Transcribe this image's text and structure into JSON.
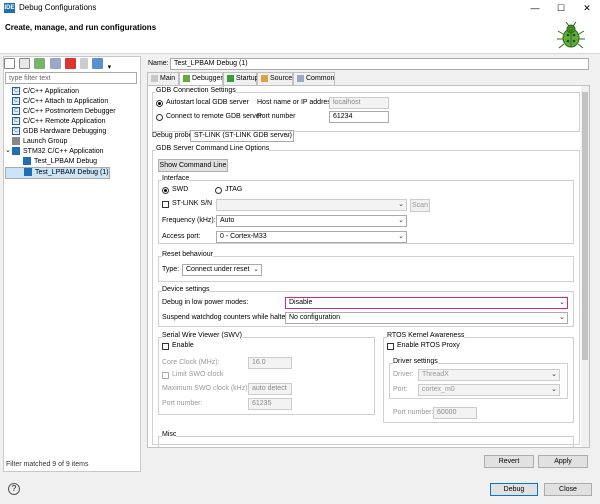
{
  "window": {
    "title": "Debug Configurations",
    "app_icon_text": "IDE",
    "minimize": "—",
    "maximize": "☐",
    "close": "✕"
  },
  "header": {
    "title": "Create, manage, and run configurations"
  },
  "left": {
    "filter_placeholder": "type filter text",
    "tree": [
      {
        "label": "C/C++ Application",
        "icon": "c-app-icon",
        "indent": 1
      },
      {
        "label": "C/C++ Attach to Application",
        "icon": "c-app-icon",
        "indent": 1
      },
      {
        "label": "C/C++ Postmortem Debugger",
        "icon": "c-app-icon",
        "indent": 1
      },
      {
        "label": "C/C++ Remote Application",
        "icon": "c-app-icon",
        "indent": 1
      },
      {
        "label": "GDB Hardware Debugging",
        "icon": "c-app-icon",
        "indent": 1
      },
      {
        "label": "Launch Group",
        "icon": "launch-group-icon",
        "indent": 1
      },
      {
        "label": "STM32 C/C++ Application",
        "icon": "ide-icon",
        "indent": 1,
        "expanded": true
      },
      {
        "label": "Test_LPBAM Debug",
        "icon": "ide-icon",
        "indent": 2
      },
      {
        "label": "Test_LPBAM Debug (1)",
        "icon": "ide-icon",
        "indent": 2,
        "selected": true
      }
    ],
    "status": "Filter matched 9 of 9 items"
  },
  "right": {
    "name_label": "Name:",
    "name_value": "Test_LPBAM Debug (1)",
    "tabs": [
      "Main",
      "Debugger",
      "Startup",
      "Source",
      "Common"
    ],
    "gdb_connection": {
      "title": "GDB Connection Settings",
      "autostart": "Autostart local GDB server",
      "connect_remote": "Connect to remote GDB server",
      "host_label": "Host name or IP address",
      "host_value": "localhost",
      "port_label": "Port number",
      "port_value": "61234"
    },
    "debug_probe_label": "Debug probe",
    "debug_probe_value": "ST-LINK (ST-LINK GDB server)",
    "gdb_server_title": "GDB Server Command Line Options",
    "show_cmd_button": "Show Command Line",
    "interface": {
      "title": "Interface",
      "swd": "SWD",
      "jtag": "JTAG",
      "stlink_sn": "ST-LINK S/N",
      "scan": "Scan",
      "freq_label": "Frequency (kHz):",
      "freq_value": "Auto",
      "access_label": "Access port:",
      "access_value": "0 - Cortex-M33"
    },
    "reset": {
      "title": "Reset behaviour",
      "type_label": "Type:",
      "type_value": "Connect under reset"
    },
    "device": {
      "title": "Device settings",
      "lowpower_label": "Debug in low power modes:",
      "lowpower_value": "Disable",
      "watchdog_label": "Suspend watchdog counters while halted:",
      "watchdog_value": "No configuration"
    },
    "swv": {
      "title": "Serial Wire Viewer (SWV)",
      "enable": "Enable",
      "core_clock_label": "Core Clock (MHz):",
      "core_clock_value": "16.0",
      "limit_swo": "Limit SWO clock",
      "max_swo_label": "Maximum SWO clock (kHz):",
      "max_swo_value": "auto detect",
      "port_label": "Port number:",
      "port_value": "61235"
    },
    "rtos": {
      "title": "RTOS Kernel Awareness",
      "enable": "Enable RTOS Proxy",
      "driver_title": "Driver settings",
      "driver_label": "Driver:",
      "driver_value": "ThreadX",
      "port_label": "Port:",
      "port_value": "cortex_m0",
      "portnum_label": "Port number:",
      "portnum_value": "60000"
    },
    "misc": {
      "title": "Misc"
    },
    "revert": "Revert",
    "apply": "Apply"
  },
  "bottom": {
    "help": "?",
    "debug": "Debug",
    "close": "Close"
  },
  "colors": {
    "highlight": "#e0208a",
    "accent": "#1f6fb5",
    "selection": "#cce4f7"
  }
}
